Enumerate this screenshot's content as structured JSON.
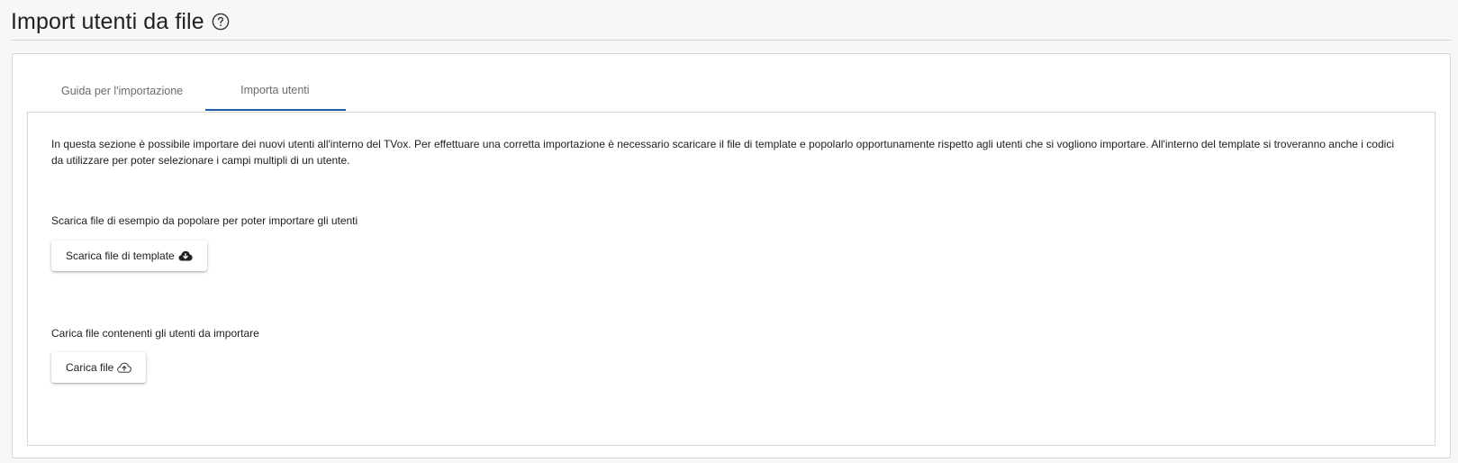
{
  "header": {
    "title": "Import utenti da file",
    "help_icon": "question-circle-icon"
  },
  "tabs": [
    {
      "label": "Guida per l'importazione",
      "active": false
    },
    {
      "label": "Importa utenti",
      "active": true
    }
  ],
  "panel": {
    "intro": "In questa sezione è possibile importare dei nuovi utenti all'interno del TVox. Per effettuare una corretta importazione è necessario scaricare il file di template e popolarlo opportunamente rispetto agli utenti che si vogliono importare. All'interno del template si troveranno anche i codici da utilizzare per poter selezionare i campi multipli di un utente.",
    "download_label": "Scarica file di esempio da popolare per poter importare gli utenti",
    "download_button": "Scarica file di template",
    "download_icon": "cloud-download-icon",
    "upload_label": "Carica file contenenti gli utenti da importare",
    "upload_button": "Carica file",
    "upload_icon": "cloud-upload-icon"
  },
  "colors": {
    "accent": "#1e5ca8",
    "border": "#d6d6d6",
    "background": "#f7f7f7"
  }
}
